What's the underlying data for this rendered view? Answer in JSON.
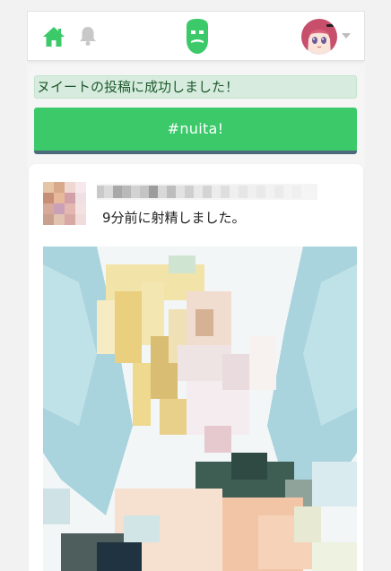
{
  "navbar": {
    "home_icon": "home-icon",
    "bell_icon": "bell-icon",
    "logo_icon": "bearded-face-logo-icon",
    "avatar_image": "user-avatar",
    "caret_icon": "caret-down-icon"
  },
  "alert": {
    "message": "ヌイートの投稿に成功しました！"
  },
  "actions": {
    "nuita_label": "#nuita!"
  },
  "post": {
    "text": "9分前に射精しました。",
    "avatar_image": "pixelated-avatar",
    "username_image": "pixelated-username",
    "image": "pixelated-illustration"
  },
  "colors": {
    "brand_green": "#3bc96a",
    "alert_bg": "#d7ecde",
    "alert_text": "#1e5a2e",
    "button_border": "#4d6a7a",
    "page_bg": "#f5f5f5"
  }
}
